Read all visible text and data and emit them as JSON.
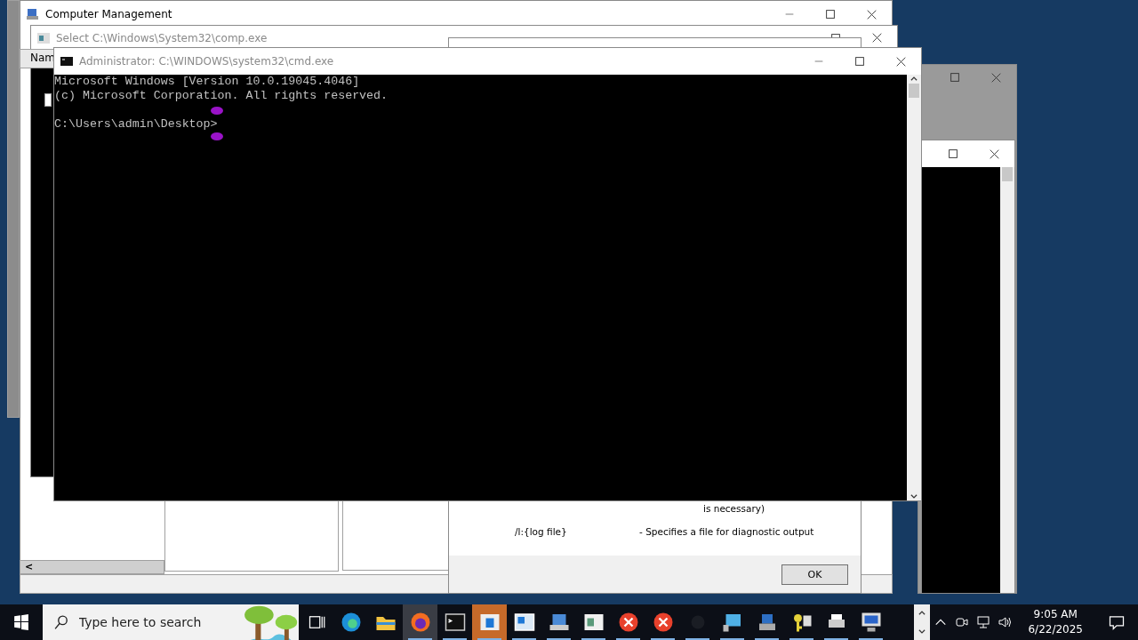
{
  "computer_management": {
    "title": "Computer Management",
    "column_header": "Nam",
    "scroll_left": "<"
  },
  "select_window": {
    "title": "Select C:\\Windows\\System32\\comp.exe"
  },
  "help_dialog": {
    "lines": [
      {
        "text": "is necessary)"
      },
      {
        "option": "/l:{log file}",
        "text": "- Specifies a file for diagnostic output"
      }
    ],
    "ok_button": "OK"
  },
  "cmd_window": {
    "title": "Administrator: C:\\WINDOWS\\system32\\cmd.exe",
    "output": [
      "Microsoft Windows [Version 10.0.19045.4046]",
      "(c) Microsoft Corporation. All rights reserved."
    ],
    "prompt": "C:\\Users\\admin\\Desktop>"
  },
  "taskbar": {
    "search": {
      "placeholder": "Type here to search"
    },
    "apps": [
      {
        "running": false,
        "selected": false
      },
      {
        "running": false,
        "selected": false
      },
      {
        "running": false,
        "selected": false
      },
      {
        "running": true,
        "selected": true
      },
      {
        "running": true,
        "selected": false
      },
      {
        "running": true,
        "selected": false,
        "flashing": true
      },
      {
        "running": true,
        "selected": false
      },
      {
        "running": true,
        "selected": false
      },
      {
        "running": true,
        "selected": false
      },
      {
        "running": true,
        "selected": false
      },
      {
        "running": true,
        "selected": false
      },
      {
        "running": true,
        "selected": false
      },
      {
        "running": true,
        "selected": false
      },
      {
        "running": true,
        "selected": false
      },
      {
        "running": true,
        "selected": false
      },
      {
        "running": true,
        "selected": false
      },
      {
        "running": true,
        "selected": false
      }
    ],
    "time": "9:05 AM",
    "date": "6/22/2025"
  }
}
